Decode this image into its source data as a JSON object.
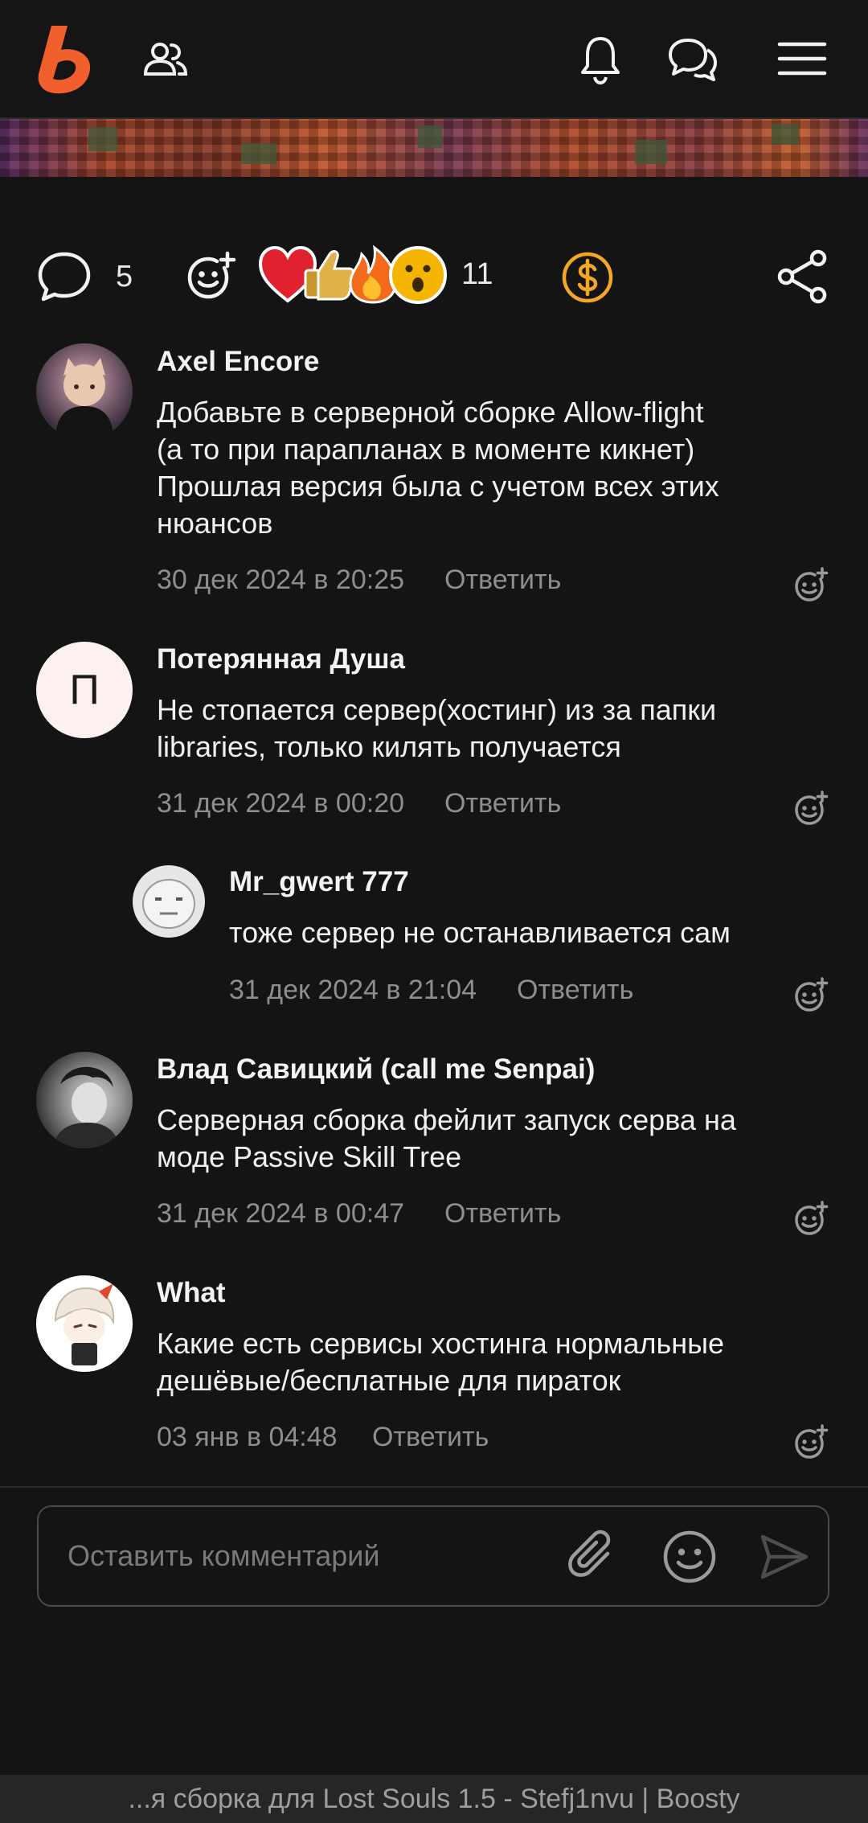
{
  "header": {
    "logo_icon": "boosty-logo",
    "subscriptions_icon": "people-icon",
    "notifications_icon": "bell-icon",
    "messages_icon": "chat-bubbles-icon",
    "menu_icon": "hamburger-menu-icon"
  },
  "reactions_bar": {
    "comments_count": "5",
    "reactions_count": "11",
    "reaction_emojis": [
      "heart",
      "thumbs-up",
      "fire",
      "wow"
    ],
    "donate_icon": "dollar-coin-icon",
    "share_icon": "share-icon",
    "accent_color": "#f5a623"
  },
  "comments": [
    {
      "author": "Axel Encore",
      "text_lines": [
        "Добавьте в серверной сборке Allow-flight",
        "(а то при парапланах в моменте кикнет)",
        "Прошлая версия была с учетом всех этих",
        "нюансов"
      ],
      "date": "30 дек 2024 в 20:25",
      "reply_label": "Ответить"
    },
    {
      "author": "Потерянная Душа",
      "avatar_letter": "П",
      "text_lines": [
        "Не стопается сервер(хостинг) из за папки",
        "libraries, только килять получается"
      ],
      "date": "31 дек 2024 в 00:20",
      "reply_label": "Ответить"
    },
    {
      "author": "Mr_gwert 777",
      "text_lines": [
        "тоже сервер не останавливается сам"
      ],
      "date": "31 дек 2024 в 21:04",
      "reply_label": "Ответить"
    },
    {
      "author": "Влад Савицкий (call me Senpai)",
      "text_lines": [
        "Серверная сборка фейлит запуск серва на",
        "моде Passive Skill Tree"
      ],
      "date": "31 дек 2024 в 00:47",
      "reply_label": "Ответить"
    },
    {
      "author": "What",
      "text_lines": [
        "Какие есть сервисы хостинга нормальные",
        "дешёвые/бесплатные для пираток"
      ],
      "date": "03 янв в 04:48",
      "reply_label": "Ответить"
    }
  ],
  "comment_input": {
    "placeholder": "Оставить комментарий",
    "attach_icon": "paperclip-icon",
    "emoji_icon": "smiley-icon",
    "send_icon": "send-icon"
  },
  "footer": {
    "title": "...я сборка для Lost Souls 1.5 - Stefj1nvu | Boosty"
  }
}
